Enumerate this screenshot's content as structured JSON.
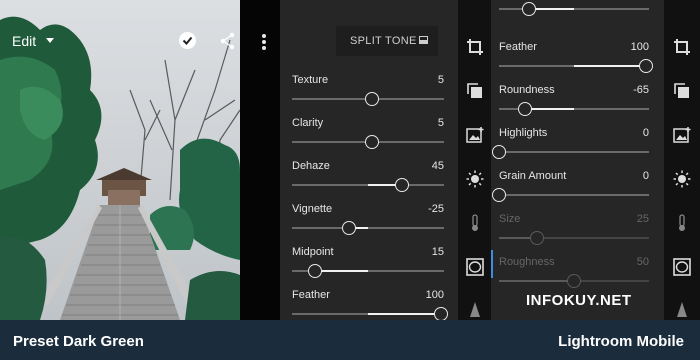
{
  "photo": {
    "edit_label": "Edit"
  },
  "panel_left": {
    "split_tone_label": "SPLIT TONE",
    "sliders": [
      {
        "name": "Texture",
        "value": "5"
      },
      {
        "name": "Clarity",
        "value": "5"
      },
      {
        "name": "Dehaze",
        "value": "45"
      },
      {
        "name": "Vignette",
        "value": "-25"
      },
      {
        "name": "Midpoint",
        "value": "15"
      },
      {
        "name": "Feather",
        "value": "100"
      }
    ]
  },
  "panel_right": {
    "sliders": [
      {
        "name": "Feather",
        "value": "100"
      },
      {
        "name": "Roundness",
        "value": "-65"
      },
      {
        "name": "Highlights",
        "value": "0"
      },
      {
        "name": "Grain Amount",
        "value": "0"
      },
      {
        "name": "Size",
        "value": "25"
      },
      {
        "name": "Roughness",
        "value": "50"
      }
    ],
    "watermark": "INFOKUY.NET"
  },
  "rail_icons": [
    "crop-icon",
    "presets-icon",
    "image-add-icon",
    "light-sun-icon",
    "color-temperature-icon",
    "vignette-icon",
    "detail-triangle-icon"
  ],
  "footer": {
    "left": "Preset Dark Green",
    "right": "Lightroom Mobile"
  },
  "colors": {
    "panel": "#262626",
    "rail": "#111111",
    "footer": "#1b2c3d",
    "active": "#3b8ee8"
  }
}
